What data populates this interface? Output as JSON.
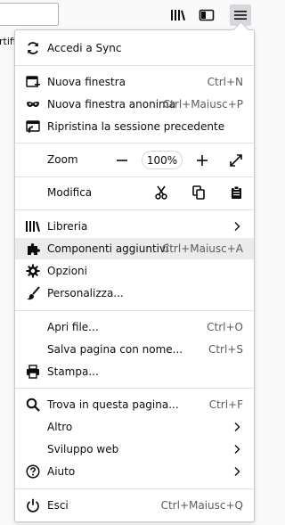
{
  "bookmarks_fragment": "rtifi",
  "menu": {
    "sync": "Accedi a Sync",
    "new_window": {
      "label": "Nuova finestra",
      "shortcut": "Ctrl+N"
    },
    "new_private": {
      "label": "Nuova finestra anonima",
      "shortcut": "Ctrl+Maiusc+P"
    },
    "restore": "Ripristina la sessione precedente",
    "zoom": {
      "label": "Zoom",
      "value": "100%"
    },
    "edit": "Modifica",
    "library": "Libreria",
    "addons": {
      "label": "Componenti aggiuntivi",
      "shortcut": "Ctrl+Maiusc+A"
    },
    "options": "Opzioni",
    "customize": "Personalizza...",
    "open_file": {
      "label": "Apri file...",
      "shortcut": "Ctrl+O"
    },
    "save_page": {
      "label": "Salva pagina con nome...",
      "shortcut": "Ctrl+S"
    },
    "print": "Stampa...",
    "find": {
      "label": "Trova in questa pagina...",
      "shortcut": "Ctrl+F"
    },
    "more": "Altro",
    "webdev": "Sviluppo web",
    "help": "Aiuto",
    "quit": {
      "label": "Esci",
      "shortcut": "Ctrl+Maiusc+Q"
    }
  }
}
